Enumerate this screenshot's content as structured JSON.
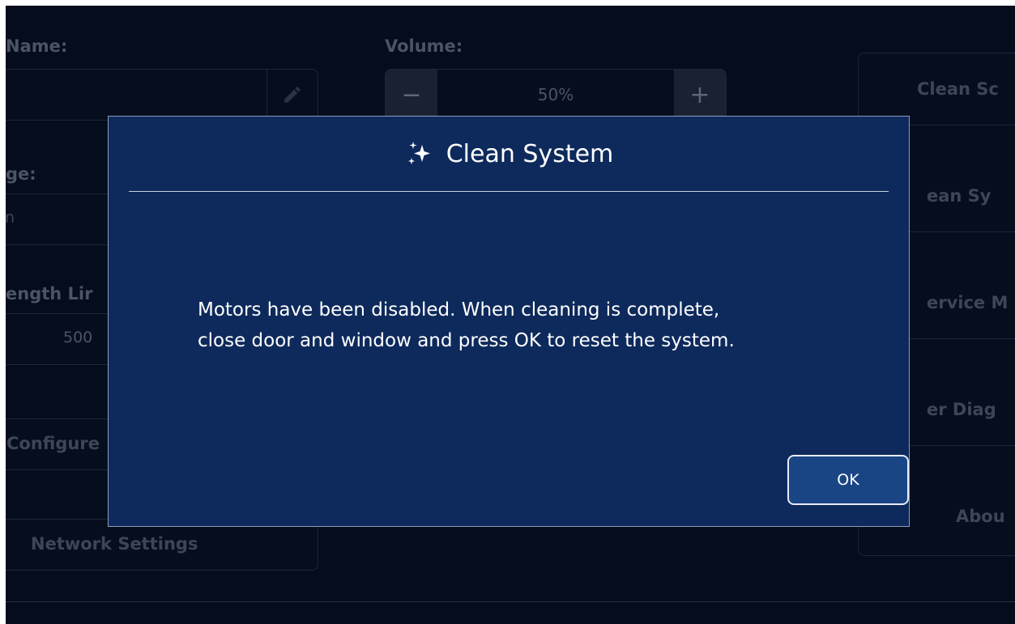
{
  "background": {
    "name_label": "Name:",
    "volume_label": "Volume:",
    "volume_value": "50%",
    "volume_minus": "−",
    "volume_plus": "+",
    "age_label": "ge:",
    "age_value": "n",
    "length_label": "ength Lir",
    "length_value": "500",
    "configure_button": "Configure",
    "network_settings_button": "Network Settings",
    "right_menu": [
      "Clean Sc",
      "ean Sy",
      "ervice M",
      "er Diag",
      "Abou"
    ]
  },
  "modal": {
    "title": "Clean System",
    "icon": "sparkle-icon",
    "message_line1": "Motors have been disabled. When cleaning is complete,",
    "message_line2": "close door and window and press OK to reset the system.",
    "ok_label": "OK"
  },
  "colors": {
    "app_background": "#050c1b",
    "modal_background": "#0e2a5c",
    "ok_button": "#1a4585"
  }
}
